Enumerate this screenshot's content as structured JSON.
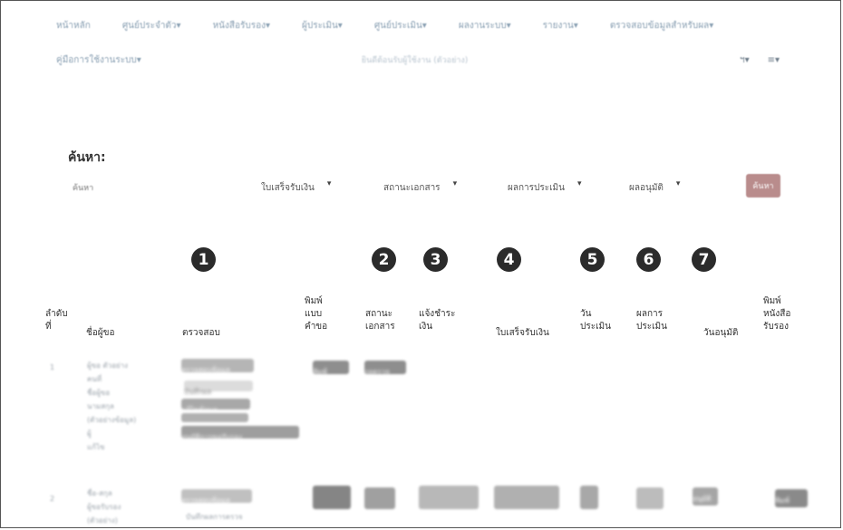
{
  "nav": {
    "items": [
      "หน้าหลัก",
      "ศูนย์ประจำตัว▾",
      "หนังสือรับรอง▾",
      "ผู้ประเมิน▾",
      "ศูนย์ประเมิน▾",
      "ผลงานระบบ▾",
      "รายงาน▾",
      "ตรวจสอบข้อมูลสำหรับผล▾"
    ],
    "row2_item": "คู่มือการใช้งานระบบ▾",
    "row2_faint": "ยินดีต้อนรับผู้ใช้งาน (ตัวอย่าง)",
    "row2_right_1": "ฯ▾",
    "row2_right_2": "≡▾"
  },
  "search": {
    "title": "ค้นหา:",
    "input_placeholder": "ค้นหา",
    "filters": [
      "ใบเสร็จรับเงิน",
      "สถานะเอกสาร",
      "ผลการประเมิน",
      "ผลอนุมัติ"
    ],
    "button_label": "ค้นหา"
  },
  "badges": [
    "1",
    "2",
    "3",
    "4",
    "5",
    "6",
    "7"
  ],
  "table": {
    "headers": [
      "ลำดับ\nที่",
      "ชื่อผู้ขอ",
      "ตรวจสอบ",
      "พิมพ์\nแบบ\nคำขอ",
      "สถานะ\nเอกสาร",
      "แจ้งชำระ\nเงิน",
      "ใบเสร็จรับเงิน",
      "วัน\nประเมิน",
      "ผลการ\nประเมิน",
      "วันอนุมัติ",
      "พิมพ์\nหนังสือ\nรับรอง"
    ],
    "row1": {
      "index": "1",
      "name": "ผู้ขอ ตัวอย่าง\nคนที่\nชื่อผู้ขอ\nนามสกุล\n(ตัวอย่างข้อมูล)\nผู้\nแก้ไข",
      "check_buttons": [
        "ตรวจสอบข้อมูล",
        "บันทึกผล",
        "แก้ไขข้อมูล",
        "อนุมัติการขอรับรอง"
      ],
      "print_form": "พิมพ์",
      "doc_status": "รอตรวจ"
    },
    "row2": {
      "index": "2",
      "name": "ชื่อ-สกุล\nผู้ขอรับรอง\n(ตัวอย่าง)",
      "check_button": "ตรวจสอบข้อมูล",
      "check_sub": "บันทึกผลการตรวจ",
      "approve_date": "อนุมัติ",
      "print_btn": "พิมพ์"
    }
  },
  "colors": {
    "nav_text": "#8aa0b3",
    "button_gray": "#9a9a9a",
    "search_button": "#b98c8c",
    "badge": "#2b2b2b"
  }
}
